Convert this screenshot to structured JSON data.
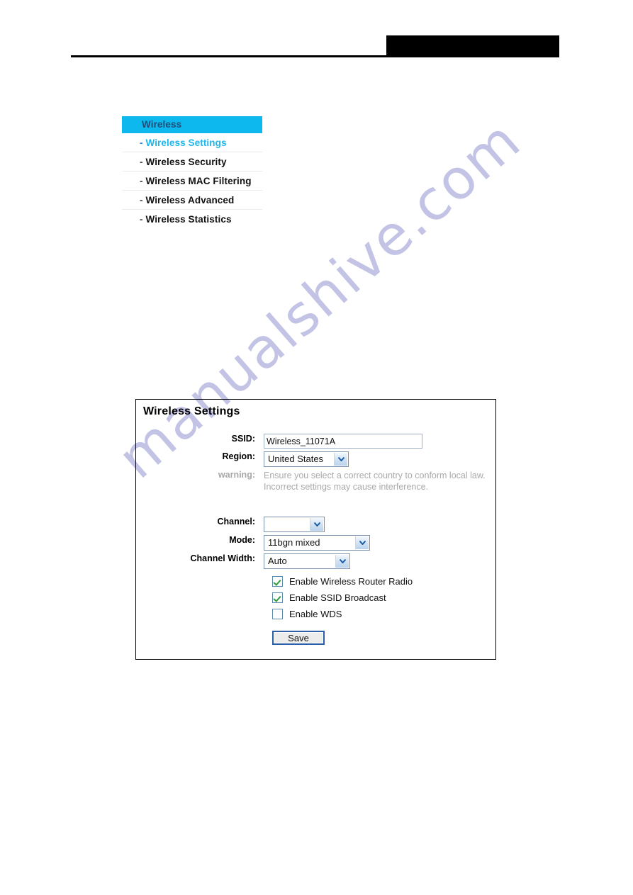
{
  "header": {
    "redaction_color": "#000000",
    "rule_color": "#000000"
  },
  "watermark": {
    "text": "manualshive.com",
    "color": "#c3c3e6"
  },
  "sidebar": {
    "title": "Wireless",
    "accent_color": "#0cb8ee",
    "items": [
      {
        "dash": "-",
        "label": "Wireless Settings",
        "active": true
      },
      {
        "dash": "-",
        "label": "Wireless Security",
        "active": false
      },
      {
        "dash": "-",
        "label": "Wireless MAC Filtering",
        "active": false
      },
      {
        "dash": "-",
        "label": "Wireless Advanced",
        "active": false
      },
      {
        "dash": "-",
        "label": "Wireless Statistics",
        "active": false
      }
    ]
  },
  "panel": {
    "title": "Wireless Settings",
    "fields": {
      "ssid": {
        "label": "SSID:",
        "value": "Wireless_11071A",
        "placeholder": ""
      },
      "region": {
        "label": "Region:",
        "value": "United States"
      },
      "warning": {
        "label": "warning:",
        "line1": "Ensure you select a correct country to conform local law.",
        "line2": "Incorrect settings may cause interference."
      },
      "channel": {
        "label": "Channel:",
        "value": ""
      },
      "mode": {
        "label": "Mode:",
        "value": "11bgn mixed"
      },
      "channel_width": {
        "label": "Channel Width:",
        "value": "Auto"
      }
    },
    "checkboxes": [
      {
        "label": "Enable Wireless Router Radio",
        "checked": true
      },
      {
        "label": "Enable SSID Broadcast",
        "checked": true
      },
      {
        "label": "Enable WDS",
        "checked": false
      }
    ],
    "save_label": "Save"
  }
}
